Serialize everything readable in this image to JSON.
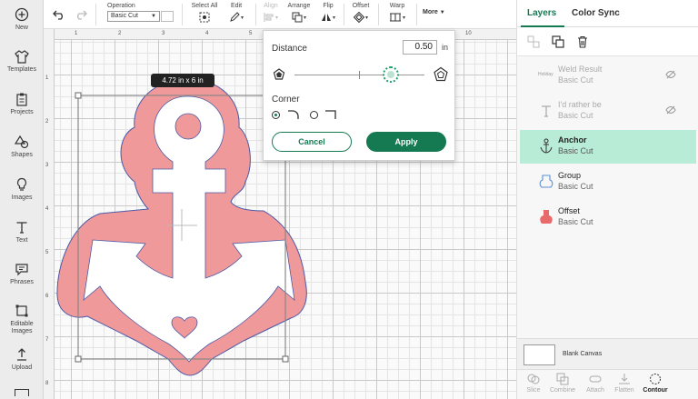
{
  "left_toolbar": [
    {
      "label": "New",
      "icon": "plus-circle-icon"
    },
    {
      "label": "Templates",
      "icon": "shirt-icon"
    },
    {
      "label": "Projects",
      "icon": "clipboard-icon"
    },
    {
      "label": "Shapes",
      "icon": "shapes-icon"
    },
    {
      "label": "Images",
      "icon": "lightbulb-icon"
    },
    {
      "label": "Text",
      "icon": "text-icon"
    },
    {
      "label": "Phrases",
      "icon": "speech-bubble-icon"
    },
    {
      "label": "Editable Images",
      "icon": "editable-image-icon"
    },
    {
      "label": "Upload",
      "icon": "upload-icon"
    }
  ],
  "top_toolbar": {
    "operation_label": "Operation",
    "operation_value": "Basic Cut",
    "select_all": "Select All",
    "edit": "Edit",
    "align": "Align",
    "arrange": "Arrange",
    "flip": "Flip",
    "offset": "Offset",
    "warp": "Warp",
    "more": "More"
  },
  "ruler": {
    "top": [
      "1",
      "2",
      "3",
      "4",
      "5",
      "6",
      "7",
      "8",
      "9",
      "10"
    ],
    "left": [
      "1",
      "2",
      "3",
      "4",
      "5",
      "6",
      "7",
      "8"
    ]
  },
  "canvas": {
    "size_tag": "4.72  in x 6  in"
  },
  "offset_popup": {
    "distance_label": "Distance",
    "distance_value": "0.50",
    "unit": "in",
    "corner_label": "Corner",
    "selected_corner": "rounded",
    "cancel": "Cancel",
    "apply": "Apply"
  },
  "right_panel": {
    "tabs": [
      "Layers",
      "Color Sync"
    ],
    "active_tab": "Layers",
    "layers": [
      {
        "name": "Weld Result",
        "sub": "Basic Cut",
        "state": "hidden",
        "icon": "weld-text-icon"
      },
      {
        "name": "I'd rather be",
        "sub": "Basic Cut",
        "state": "hidden",
        "icon": "text-layer-icon"
      },
      {
        "name": "Anchor",
        "sub": "Basic Cut",
        "state": "selected",
        "icon": "anchor-icon"
      },
      {
        "name": "Group",
        "sub": "Basic Cut",
        "state": "normal",
        "icon": "group-icon"
      },
      {
        "name": "Offset",
        "sub": "Basic Cut",
        "state": "normal",
        "icon": "offset-shape-icon"
      }
    ],
    "blank_canvas": "Blank Canvas",
    "actions": [
      {
        "label": "Slice",
        "enabled": false
      },
      {
        "label": "Combine",
        "enabled": false
      },
      {
        "label": "Attach",
        "enabled": false
      },
      {
        "label": "Flatten",
        "enabled": false
      },
      {
        "label": "Contour",
        "enabled": true
      }
    ]
  },
  "colors": {
    "accent": "#157a52",
    "offset_fill": "#f0999a",
    "selected_row": "#b9ecd6"
  }
}
